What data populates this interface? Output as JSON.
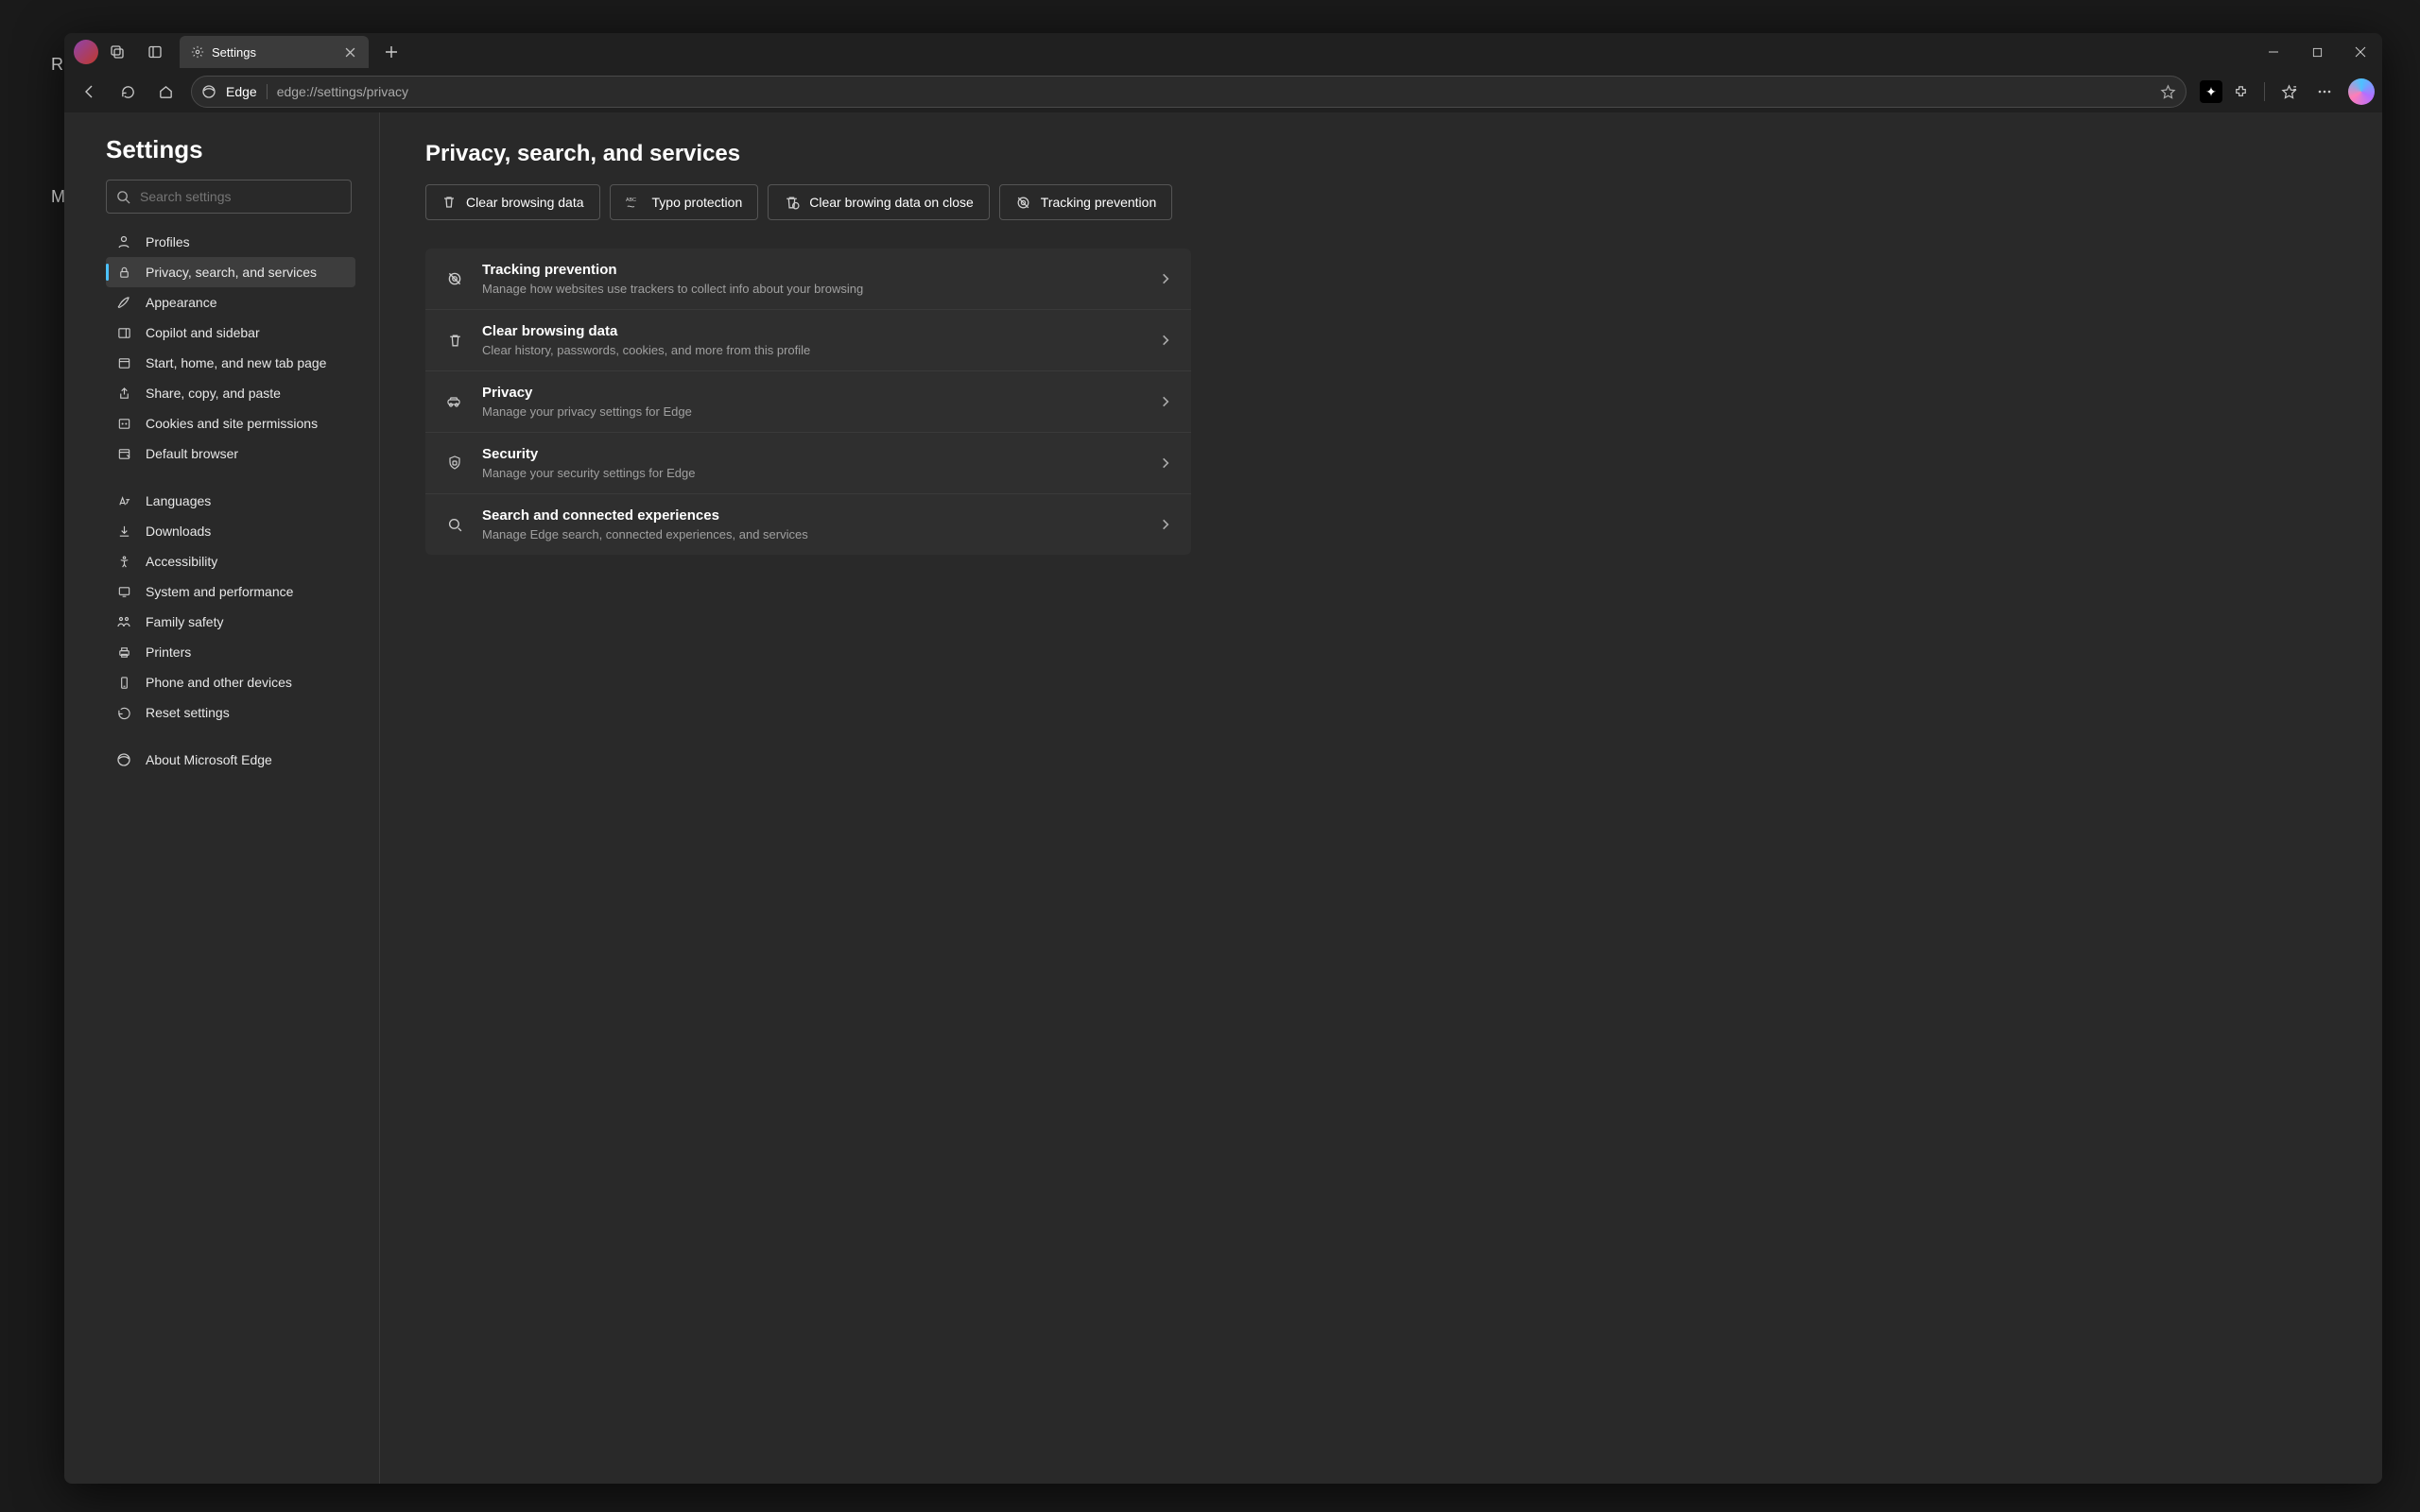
{
  "bg_letters": {
    "r": "R",
    "m": "M"
  },
  "tab": {
    "title": "Settings"
  },
  "omnibox": {
    "origin": "Edge",
    "url": "edge://settings/privacy"
  },
  "sidebar": {
    "title": "Settings",
    "search_placeholder": "Search settings",
    "group1": [
      {
        "label": "Profiles",
        "icon": "profile"
      },
      {
        "label": "Privacy, search, and services",
        "icon": "lock",
        "active": true
      },
      {
        "label": "Appearance",
        "icon": "brush"
      },
      {
        "label": "Copilot and sidebar",
        "icon": "sidebar"
      },
      {
        "label": "Start, home, and new tab page",
        "icon": "home-new"
      },
      {
        "label": "Share, copy, and paste",
        "icon": "share"
      },
      {
        "label": "Cookies and site permissions",
        "icon": "cookie"
      },
      {
        "label": "Default browser",
        "icon": "browser"
      }
    ],
    "group2": [
      {
        "label": "Languages",
        "icon": "lang"
      },
      {
        "label": "Downloads",
        "icon": "download"
      },
      {
        "label": "Accessibility",
        "icon": "accessibility"
      },
      {
        "label": "System and performance",
        "icon": "system"
      },
      {
        "label": "Family safety",
        "icon": "family"
      },
      {
        "label": "Printers",
        "icon": "printer"
      },
      {
        "label": "Phone and other devices",
        "icon": "phone"
      },
      {
        "label": "Reset settings",
        "icon": "reset"
      }
    ],
    "group3": [
      {
        "label": "About Microsoft Edge",
        "icon": "edge"
      }
    ]
  },
  "main": {
    "heading": "Privacy, search, and services",
    "pills": [
      {
        "label": "Clear browsing data",
        "icon": "trash"
      },
      {
        "label": "Typo protection",
        "icon": "abc"
      },
      {
        "label": "Clear browing data on close",
        "icon": "trash-close"
      },
      {
        "label": "Tracking prevention",
        "icon": "track"
      }
    ],
    "rows": [
      {
        "title": "Tracking prevention",
        "sub": "Manage how websites use trackers to collect info about your browsing",
        "icon": "track"
      },
      {
        "title": "Clear browsing data",
        "sub": "Clear history, passwords, cookies, and more from this profile",
        "icon": "trash"
      },
      {
        "title": "Privacy",
        "sub": "Manage your privacy settings for Edge",
        "icon": "car"
      },
      {
        "title": "Security",
        "sub": "Manage your security settings for Edge",
        "icon": "shield"
      },
      {
        "title": "Search and connected experiences",
        "sub": "Manage Edge search, connected experiences, and services",
        "icon": "search"
      }
    ]
  }
}
